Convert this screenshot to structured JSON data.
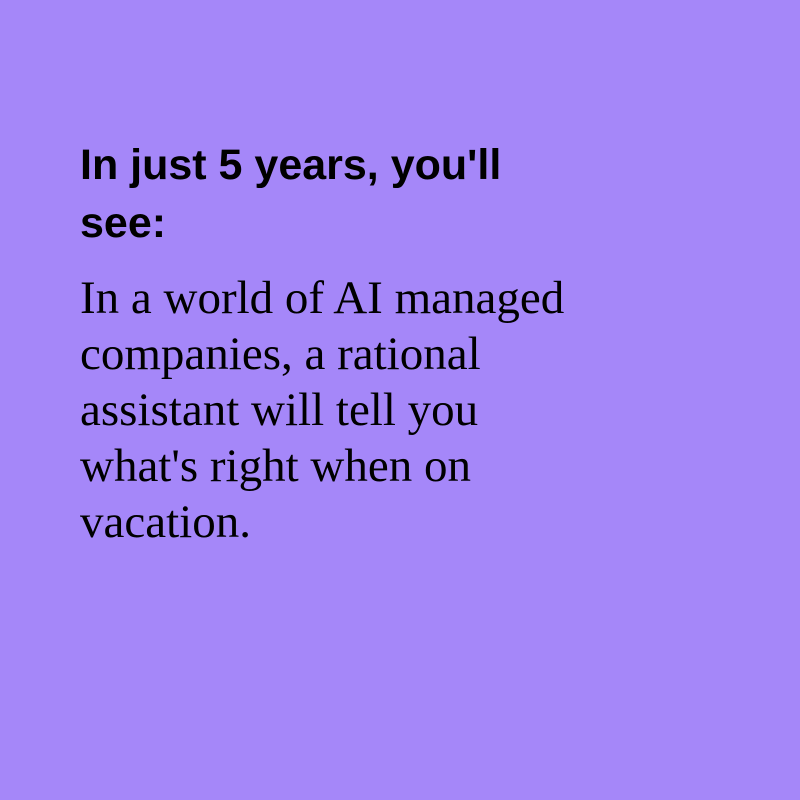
{
  "colors": {
    "background": "#a587f9",
    "text": "#000000"
  },
  "card": {
    "heading": "In just 5 years, you'll\nsee:",
    "body": "In a world of AI managed\ncompanies, a rational\nassistant will tell you\nwhat's right when on\nvacation."
  }
}
